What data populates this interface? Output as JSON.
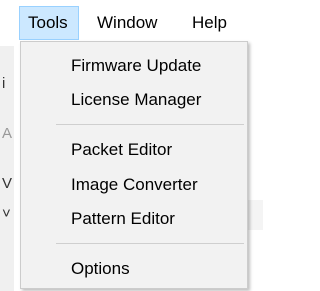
{
  "menubar": {
    "items": [
      {
        "label": "Tools",
        "active": true
      },
      {
        "label": "Window",
        "active": false
      },
      {
        "label": "Help",
        "active": false
      }
    ]
  },
  "background": {
    "fragments": [
      "i",
      "A",
      "V",
      "˅"
    ]
  },
  "tools_menu": {
    "groups": [
      [
        "Firmware Update",
        "License Manager"
      ],
      [
        "Packet Editor",
        "Image Converter",
        "Pattern Editor"
      ],
      [
        "Options"
      ]
    ]
  },
  "colors": {
    "menubar_active_bg": "#cce8ff",
    "menubar_active_border": "#99d1ff",
    "dropdown_bg": "#f2f2f2",
    "separator": "#cfcfcf"
  }
}
